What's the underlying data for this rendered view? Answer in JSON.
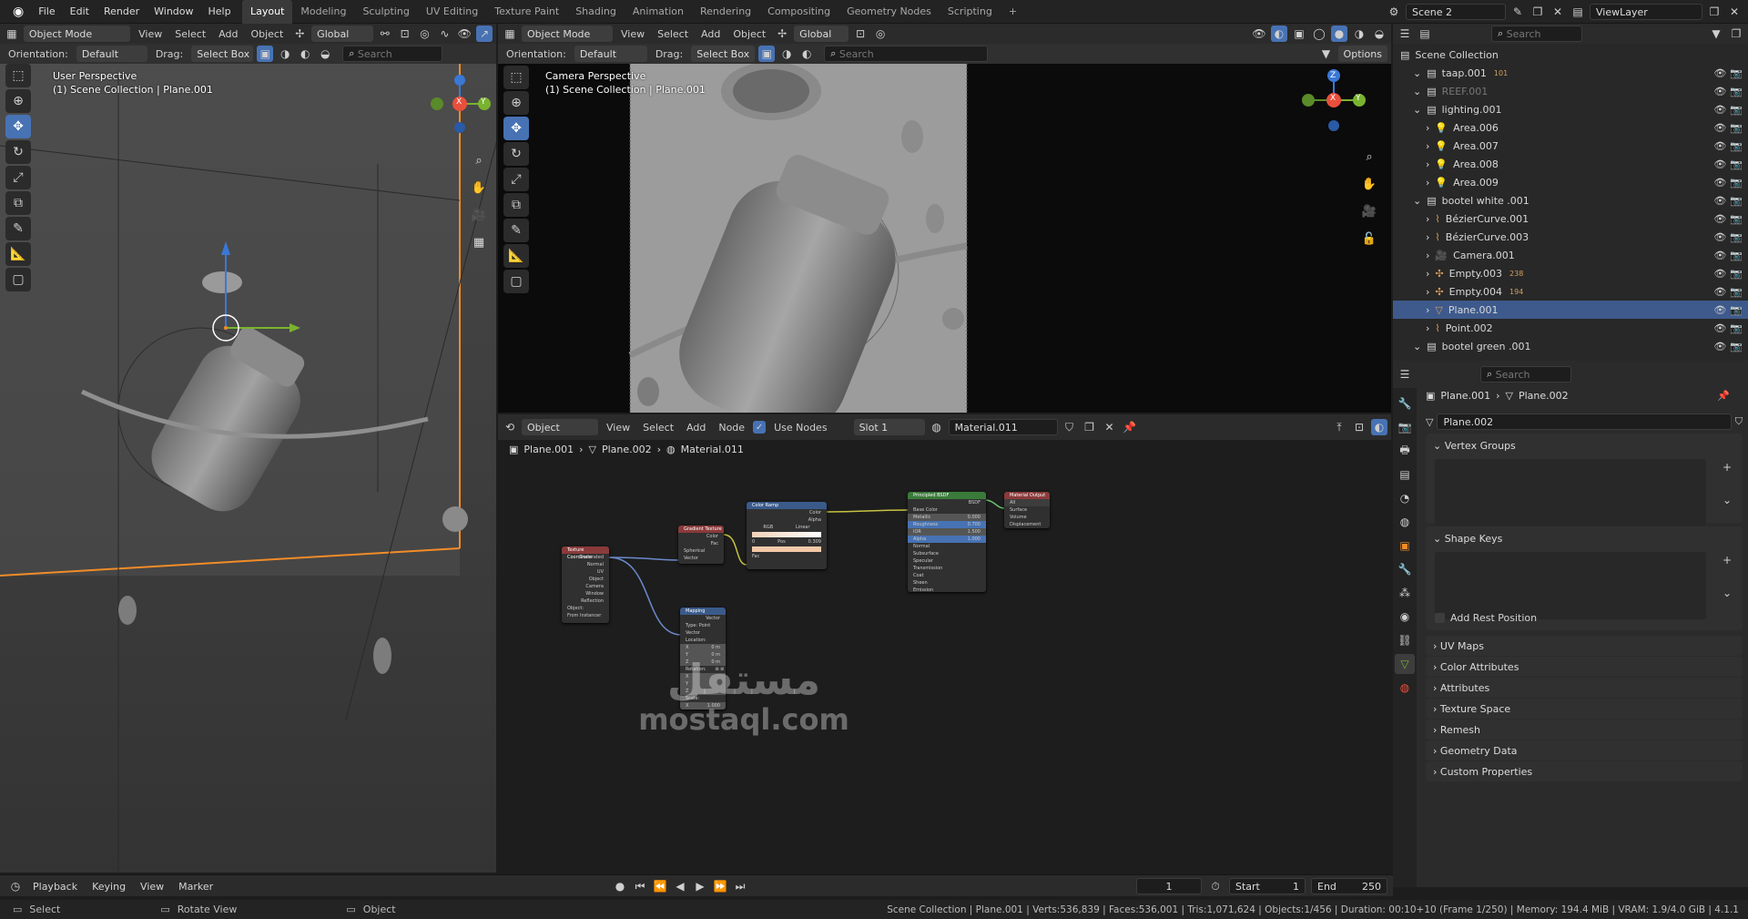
{
  "menu": [
    "File",
    "Edit",
    "Render",
    "Window",
    "Help"
  ],
  "workspaces": [
    {
      "label": "Layout",
      "active": true
    },
    {
      "label": "Modeling"
    },
    {
      "label": "Sculpting"
    },
    {
      "label": "UV Editing"
    },
    {
      "label": "Texture Paint"
    },
    {
      "label": "Shading"
    },
    {
      "label": "Animation"
    },
    {
      "label": "Rendering"
    },
    {
      "label": "Compositing"
    },
    {
      "label": "Geometry Nodes"
    },
    {
      "label": "Scripting"
    }
  ],
  "add_workspace": "+",
  "scene_name": "Scene 2",
  "view_layer": "ViewLayer",
  "viewport_left": {
    "mode": "Object Mode",
    "menus": [
      "View",
      "Select",
      "Add",
      "Object"
    ],
    "transform": "Global",
    "orientation_label": "Orientation:",
    "orientation": "Default",
    "drag_label": "Drag:",
    "drag": "Select Box",
    "search_placeholder": "Search",
    "perspective": "User Perspective",
    "collection": "(1) Scene Collection | Plane.001",
    "axis_x": "X",
    "axis_y": "Y"
  },
  "viewport_right": {
    "mode": "Object Mode",
    "menus": [
      "View",
      "Select",
      "Add",
      "Object"
    ],
    "transform": "Global",
    "orientation_label": "Orientation:",
    "orientation": "Default",
    "drag_label": "Drag:",
    "drag": "Select Box",
    "search_placeholder": "Search",
    "options": "Options",
    "perspective": "Camera Perspective",
    "collection": "(1) Scene Collection | Plane.001",
    "axis_x": "X",
    "axis_y": "Y",
    "axis_z": "Z"
  },
  "node_editor": {
    "type": "Object",
    "menus": [
      "View",
      "Select",
      "Add",
      "Node"
    ],
    "use_nodes": "Use Nodes",
    "slot": "Slot 1",
    "material": "Material.011",
    "breadcrumb": [
      "Plane.001",
      "Plane.002",
      "Material.011"
    ],
    "nodes": {
      "texcoord": {
        "title": "Texture Coordinate",
        "rows": [
          "Generated",
          "Normal",
          "UV",
          "Object",
          "Camera",
          "Window",
          "Reflection",
          "Object:",
          "From Instancer"
        ]
      },
      "gradient": {
        "title": "Gradient Texture",
        "rows": [
          "Color",
          "Fac",
          "Spherical",
          "Vector"
        ]
      },
      "colorramp": {
        "title": "Color Ramp",
        "rows": [
          "Color",
          "Alpha",
          "RGB",
          "Linear",
          "0",
          "Pos",
          "0.309",
          "Fac"
        ]
      },
      "mapping": {
        "title": "Mapping",
        "rows": [
          "Vector",
          "Type:",
          "Point",
          "Vector",
          "Location:",
          "X",
          "0 m",
          "Y",
          "0 m",
          "Z",
          "0 m",
          "Rotation:",
          "X",
          "Y",
          "Z",
          "Scale:",
          "X",
          "1.000",
          "Y",
          "Z"
        ]
      },
      "bsdf": {
        "title": "Principled BSDF",
        "rows": [
          "BSDF",
          "Base Color",
          "Metallic",
          "0.000",
          "Roughness",
          "0.700",
          "IOR",
          "1.500",
          "Alpha",
          "1.000",
          "Normal",
          "Subsurface",
          "Specular",
          "Transmission",
          "Coat",
          "Sheen",
          "Emission"
        ]
      },
      "output": {
        "title": "Material Output",
        "rows": [
          "All",
          "Surface",
          "Volume",
          "Displacement"
        ]
      }
    }
  },
  "outliner": {
    "search_placeholder": "Search",
    "root": "Scene Collection",
    "items": [
      {
        "name": "taap.001",
        "level": 1,
        "badge": "101",
        "type": "collection"
      },
      {
        "name": "REEF.001",
        "level": 1,
        "type": "collection",
        "dim": true
      },
      {
        "name": "lighting.001",
        "level": 1,
        "type": "collection"
      },
      {
        "name": "Area.006",
        "level": 2,
        "type": "light"
      },
      {
        "name": "Area.007",
        "level": 2,
        "type": "light"
      },
      {
        "name": "Area.008",
        "level": 2,
        "type": "light"
      },
      {
        "name": "Area.009",
        "level": 2,
        "type": "light"
      },
      {
        "name": "bootel white .001",
        "level": 1,
        "type": "collection"
      },
      {
        "name": "BézierCurve.001",
        "level": 2,
        "type": "curve"
      },
      {
        "name": "BézierCurve.003",
        "level": 2,
        "type": "curve"
      },
      {
        "name": "Camera.001",
        "level": 2,
        "type": "camera"
      },
      {
        "name": "Empty.003",
        "level": 2,
        "badge": "238",
        "type": "empty"
      },
      {
        "name": "Empty.004",
        "level": 2,
        "badge": "194",
        "type": "empty"
      },
      {
        "name": "Plane.001",
        "level": 2,
        "type": "mesh",
        "selected": true
      },
      {
        "name": "Point.002",
        "level": 2,
        "type": "curve"
      },
      {
        "name": "bootel green .001",
        "level": 1,
        "type": "collection"
      }
    ]
  },
  "properties": {
    "search_placeholder": "Search",
    "object": "Plane.001",
    "mesh": "Plane.002",
    "data_name": "Plane.002",
    "panels_open": [
      "Vertex Groups",
      "Shape Keys"
    ],
    "add_rest_position": "Add Rest Position",
    "panels_closed": [
      "UV Maps",
      "Color Attributes",
      "Attributes",
      "Texture Space",
      "Remesh",
      "Geometry Data",
      "Custom Properties"
    ]
  },
  "timeline": {
    "menus": [
      "Playback",
      "Keying",
      "View",
      "Marker"
    ],
    "current_frame": "1",
    "start_label": "Start",
    "start": "1",
    "end_label": "End",
    "end": "250"
  },
  "status": {
    "select": "Select",
    "rotate": "Rotate View",
    "object": "Object",
    "info": "Scene Collection | Plane.001 | Verts:536,839 | Faces:536,001 | Tris:1,071,624 | Objects:1/456 | Duration: 00:10+10 (Frame 1/250) | Memory: 194.4 MiB | VRAM: 1.9/4.0 GiB | 4.1.1"
  },
  "watermark": {
    "arabic": "مستقل",
    "latin": "mostaql.com"
  },
  "colors": {
    "accent": "#4772b3",
    "selection_orange": "#f28c28",
    "x_axis": "#e8503c",
    "y_axis": "#7ab330",
    "z_axis": "#3a78d6"
  }
}
